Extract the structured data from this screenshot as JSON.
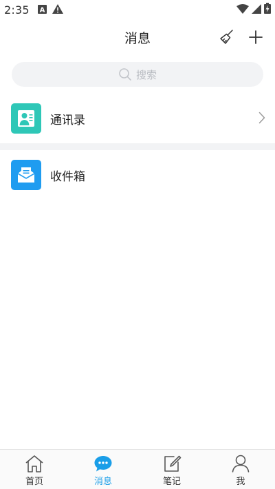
{
  "status_bar": {
    "time": "2:35"
  },
  "header": {
    "title": "消息"
  },
  "search": {
    "placeholder": "搜索"
  },
  "list": {
    "items": [
      {
        "label": "通讯录",
        "icon": "contacts-icon",
        "color": "#2ec7b7"
      },
      {
        "label": "收件箱",
        "icon": "inbox-icon",
        "color": "#1f9cf0"
      }
    ]
  },
  "bottom_nav": {
    "items": [
      {
        "label": "首页",
        "icon": "home-icon"
      },
      {
        "label": "消息",
        "icon": "message-icon",
        "active": true
      },
      {
        "label": "笔记",
        "icon": "note-icon"
      },
      {
        "label": "我",
        "icon": "profile-icon"
      }
    ],
    "active_color": "#1a9ee8"
  }
}
